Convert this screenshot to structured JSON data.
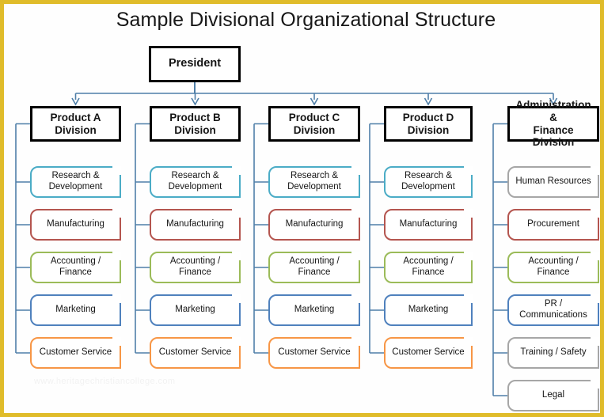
{
  "title": "Sample Divisional Organizational Structure",
  "watermark": "www.heritagechristiancollege.com",
  "colors": {
    "frame": "#e0bc2a",
    "connector": "#4f7fa8",
    "node_border": "#000000",
    "teal": "#4bacc6",
    "red": "#b4554f",
    "green": "#9bbb59",
    "blue": "#4f81bd",
    "orange": "#f79646",
    "gray": "#a6a6a6",
    "background": "#fefefe",
    "text": "#151515"
  },
  "root": {
    "label": "President"
  },
  "columns": [
    {
      "division": "Product  A\nDivision",
      "division_line1": "Product  A",
      "division_line2": "Division",
      "items": [
        {
          "label": "Research &\nDevelopment",
          "line1": "Research &",
          "line2": "Development",
          "color": "teal"
        },
        {
          "label": "Manufacturing",
          "line1": "Manufacturing",
          "line2": "",
          "color": "red"
        },
        {
          "label": "Accounting / Finance",
          "line1": "Accounting / Finance",
          "line2": "",
          "color": "green"
        },
        {
          "label": "Marketing",
          "line1": "Marketing",
          "line2": "",
          "color": "blue"
        },
        {
          "label": "Customer Service",
          "line1": "Customer Service",
          "line2": "",
          "color": "orange"
        }
      ]
    },
    {
      "division": "Product  B\nDivision",
      "division_line1": "Product  B",
      "division_line2": "Division",
      "items": [
        {
          "label": "Research &\nDevelopment",
          "line1": "Research &",
          "line2": "Development",
          "color": "teal"
        },
        {
          "label": "Manufacturing",
          "line1": "Manufacturing",
          "line2": "",
          "color": "red"
        },
        {
          "label": "Accounting / Finance",
          "line1": "Accounting / Finance",
          "line2": "",
          "color": "green"
        },
        {
          "label": "Marketing",
          "line1": "Marketing",
          "line2": "",
          "color": "blue"
        },
        {
          "label": "Customer Service",
          "line1": "Customer Service",
          "line2": "",
          "color": "orange"
        }
      ]
    },
    {
      "division": "Product  C\nDivision",
      "division_line1": "Product  C",
      "division_line2": "Division",
      "items": [
        {
          "label": "Research &\nDevelopment",
          "line1": "Research &",
          "line2": "Development",
          "color": "teal"
        },
        {
          "label": "Manufacturing",
          "line1": "Manufacturing",
          "line2": "",
          "color": "red"
        },
        {
          "label": "Accounting / Finance",
          "line1": "Accounting / Finance",
          "line2": "",
          "color": "green"
        },
        {
          "label": "Marketing",
          "line1": "Marketing",
          "line2": "",
          "color": "blue"
        },
        {
          "label": "Customer Service",
          "line1": "Customer Service",
          "line2": "",
          "color": "orange"
        }
      ]
    },
    {
      "division": "Product  D\nDivision",
      "division_line1": "Product  D",
      "division_line2": "Division",
      "items": [
        {
          "label": "Research &\nDevelopment",
          "line1": "Research &",
          "line2": "Development",
          "color": "teal"
        },
        {
          "label": "Manufacturing",
          "line1": "Manufacturing",
          "line2": "",
          "color": "red"
        },
        {
          "label": "Accounting /\nFinance",
          "line1": "Accounting /",
          "line2": "Finance",
          "color": "green"
        },
        {
          "label": "Marketing",
          "line1": "Marketing",
          "line2": "",
          "color": "blue"
        },
        {
          "label": "Customer Service",
          "line1": "Customer Service",
          "line2": "",
          "color": "orange"
        }
      ]
    },
    {
      "division": "Administration &\nFinance Division",
      "division_line1": "Administration &",
      "division_line2": "Finance Division",
      "items": [
        {
          "label": "Human Resources",
          "line1": "Human Resources",
          "line2": "",
          "color": "gray"
        },
        {
          "label": "Procurement",
          "line1": "Procurement",
          "line2": "",
          "color": "red"
        },
        {
          "label": "Accounting / Finance",
          "line1": "Accounting / Finance",
          "line2": "",
          "color": "green"
        },
        {
          "label": "PR / Communications",
          "line1": "PR / Communications",
          "line2": "",
          "color": "blue"
        },
        {
          "label": "Training / Safety",
          "line1": "Training / Safety",
          "line2": "",
          "color": "gray"
        },
        {
          "label": "Legal",
          "line1": "Legal",
          "line2": "",
          "color": "gray"
        }
      ]
    }
  ]
}
